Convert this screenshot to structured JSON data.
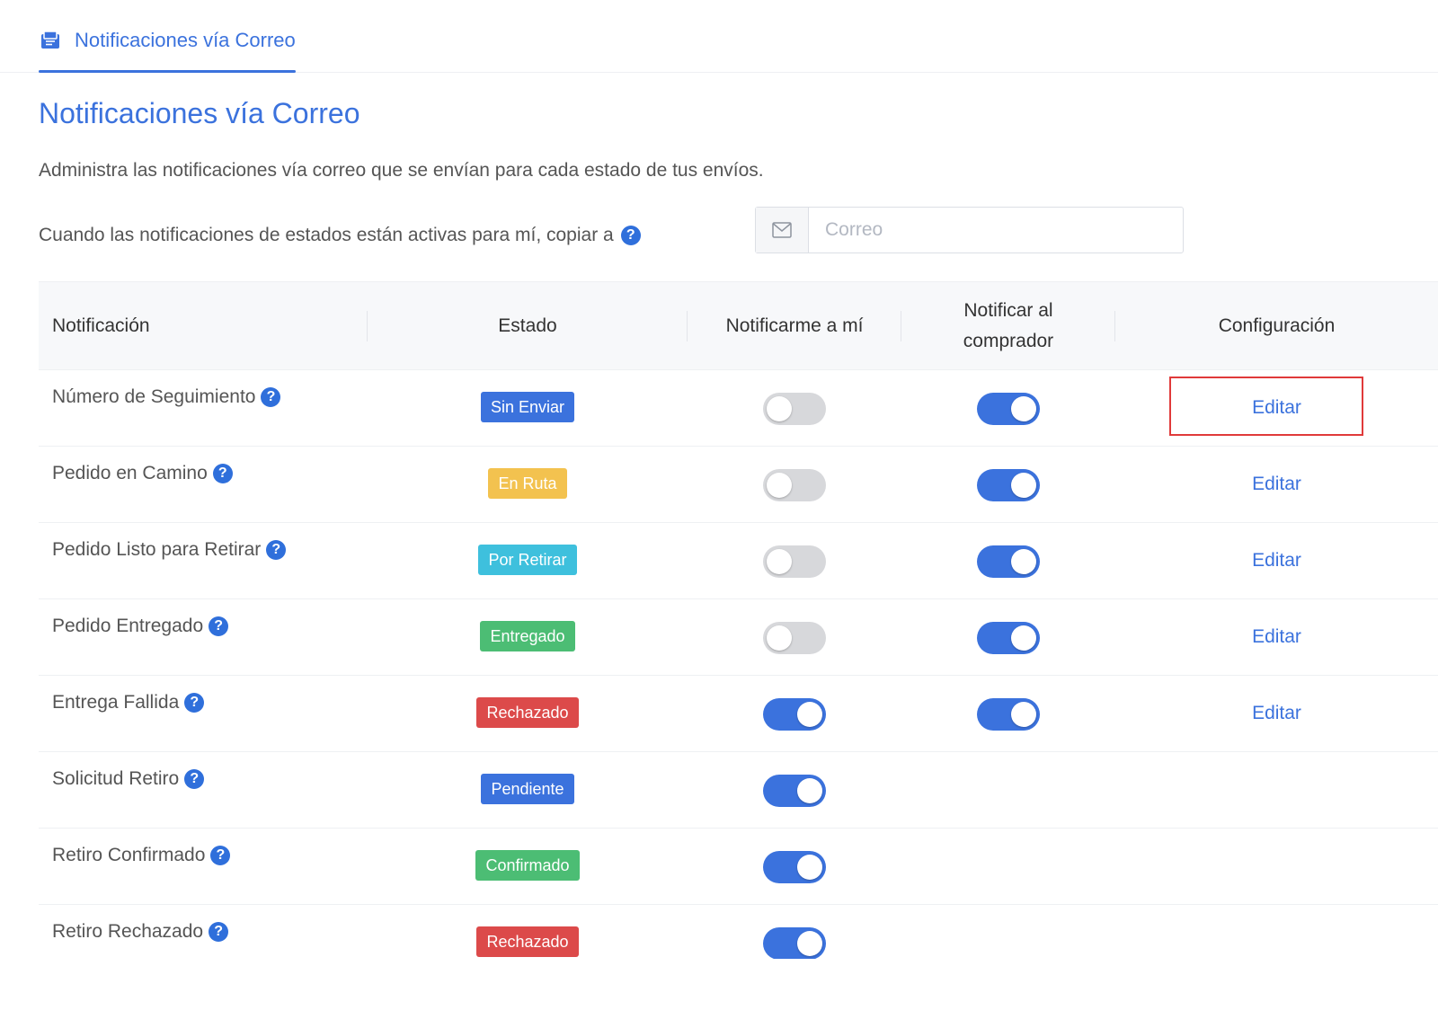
{
  "tab": {
    "label": "Notificaciones vía Correo",
    "icon": "mail-card-icon"
  },
  "header": {
    "title": "Notificaciones vía Correo",
    "description": "Administra las notificaciones vía correo que se envían para cada estado de tus envíos."
  },
  "copy": {
    "label": "Cuando las notificaciones de estados están activas para mí, copiar a",
    "help": "?",
    "email_placeholder": "Correo",
    "email_value": ""
  },
  "table": {
    "headers": {
      "notificacion": "Notificación",
      "estado": "Estado",
      "notificarme": "Notificarme a mí",
      "notificar_comprador": "Notificar al comprador",
      "configuracion": "Configuración"
    },
    "rows": [
      {
        "name": "Número de Seguimiento",
        "status": "Sin Enviar",
        "status_color": "#3b72dd",
        "me": false,
        "buyer": true,
        "edit": "Editar"
      },
      {
        "name": "Pedido en Camino",
        "status": "En Ruta",
        "status_color": "#f3c24f",
        "me": false,
        "buyer": true,
        "edit": "Editar"
      },
      {
        "name": "Pedido Listo para Retirar",
        "status": "Por Retirar",
        "status_color": "#3ec0dd",
        "me": false,
        "buyer": true,
        "edit": "Editar"
      },
      {
        "name": "Pedido Entregado",
        "status": "Entregado",
        "status_color": "#4cbd74",
        "me": false,
        "buyer": true,
        "edit": "Editar"
      },
      {
        "name": "Entrega Fallida",
        "status": "Rechazado",
        "status_color": "#dc4a4a",
        "me": true,
        "buyer": true,
        "edit": "Editar"
      },
      {
        "name": "Solicitud Retiro",
        "status": "Pendiente",
        "status_color": "#3b72dd",
        "me": true,
        "buyer": null,
        "edit": null
      },
      {
        "name": "Retiro Confirmado",
        "status": "Confirmado",
        "status_color": "#4cbd74",
        "me": true,
        "buyer": null,
        "edit": null
      },
      {
        "name": "Retiro Rechazado",
        "status": "Rechazado",
        "status_color": "#dc4a4a",
        "me": true,
        "buyer": null,
        "edit": null
      }
    ]
  },
  "colors": {
    "accent": "#3b72dd",
    "highlight": "#e03a3a"
  }
}
